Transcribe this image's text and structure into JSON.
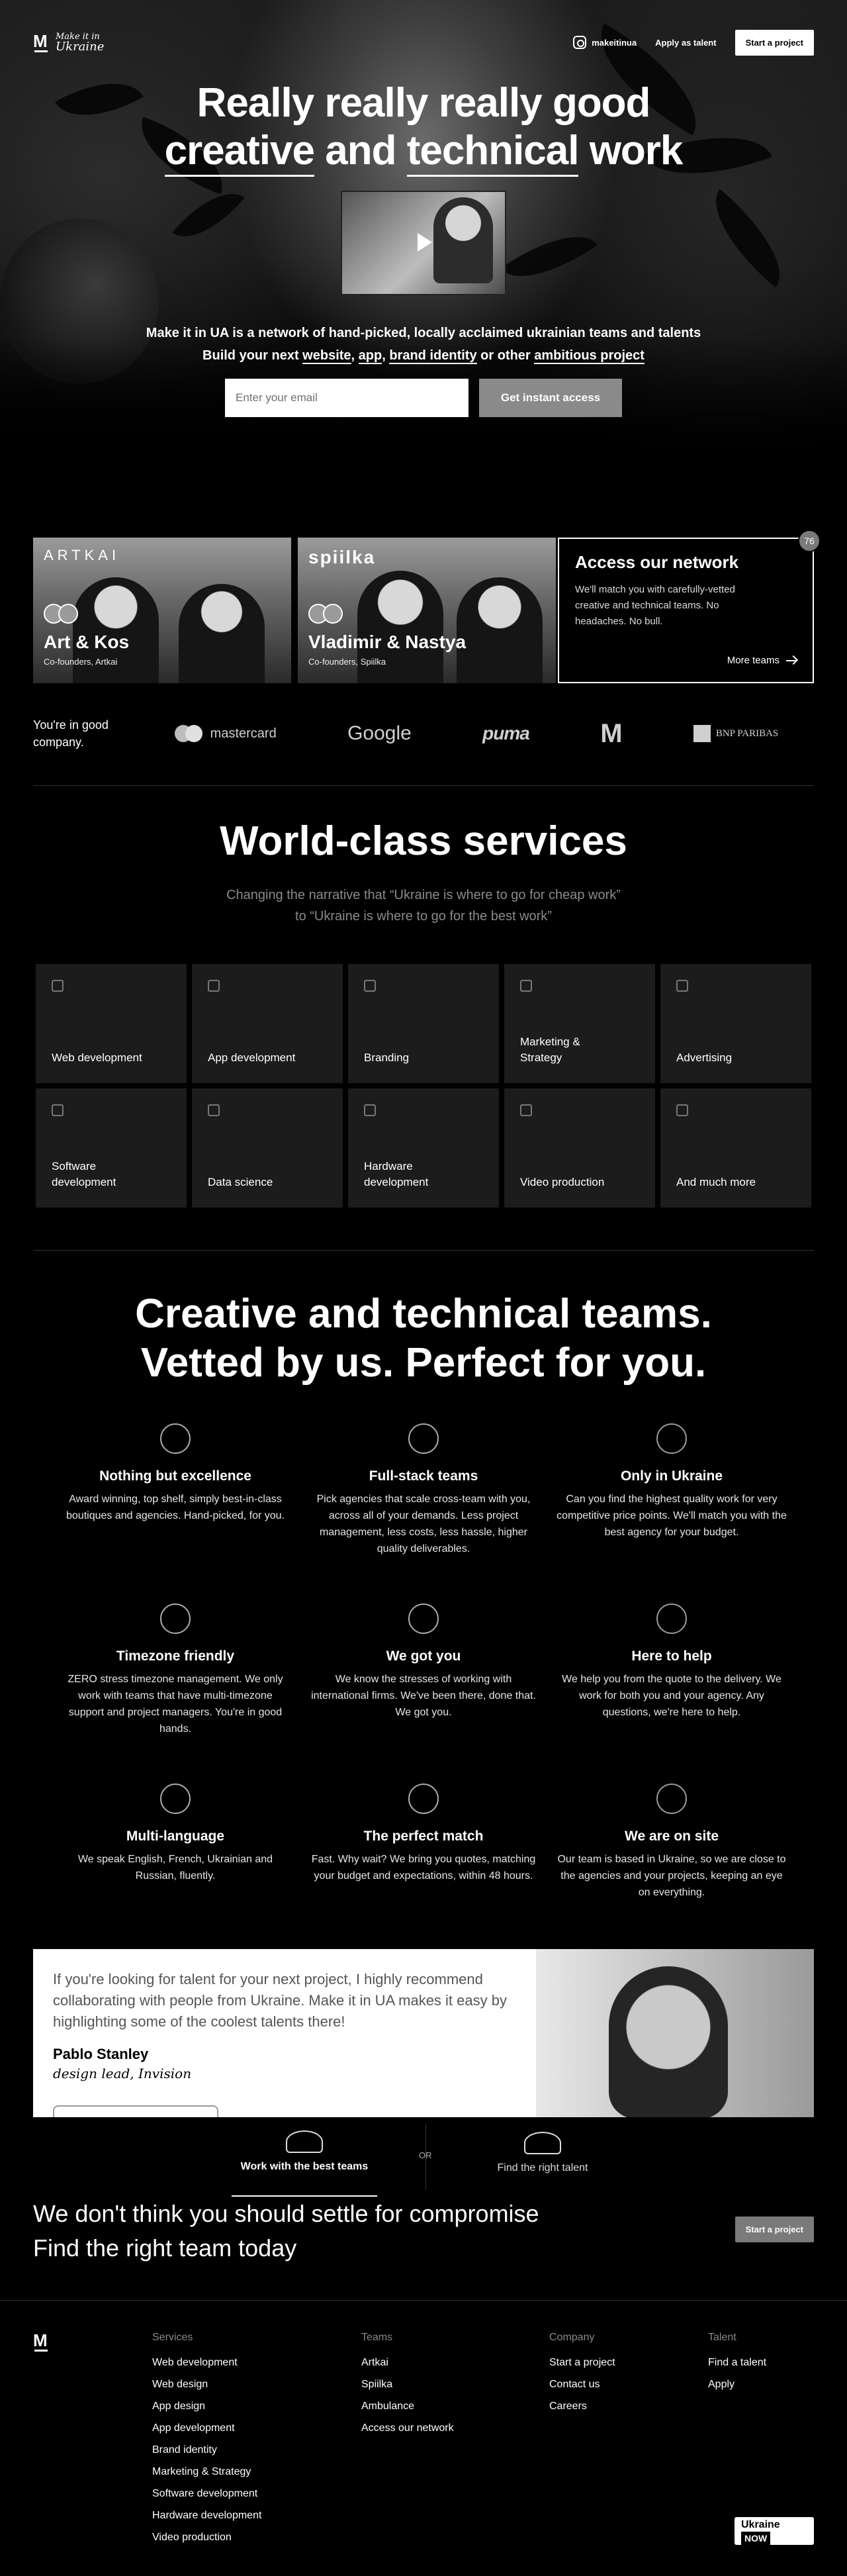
{
  "nav": {
    "logo_line1": "Make it in",
    "logo_line2": "Ukraine",
    "instagram_label": "makeitinua",
    "apply_label": "Apply as talent",
    "start_project_label": "Start a project"
  },
  "hero": {
    "title_line1": "Really really really good",
    "title_line2_a": "creative",
    "title_line2_b": "and",
    "title_line2_c": "technical",
    "title_line2_d": "work",
    "subtitle": "Make it in UA is a network of hand-picked, locally acclaimed ukrainian teams and talents",
    "sub2": {
      "prefix": "Build your next",
      "website": "website",
      "app": "app",
      "brand": "brand identity",
      "or_other": "or other",
      "ambitious": "ambitious project"
    },
    "email_placeholder": "Enter your email",
    "cta_label": "Get instant access"
  },
  "teams": [
    {
      "brand": "ARTKAI",
      "name": "Art & Kos",
      "role": "Co-founders, Artkai"
    },
    {
      "brand": "spiilka",
      "name": "Vladimir & Nastya",
      "role": "Co-founders, Spiilka"
    }
  ],
  "access_card": {
    "title": "Access our network",
    "text": "We'll match you with carefully-vetted creative and technical teams. No headaches. No bull.",
    "link": "More teams",
    "badge": "76"
  },
  "clients": {
    "label": "You're in good company.",
    "mastercard": "mastercard",
    "google": "Google",
    "puma": "puma",
    "mcdonalds": "M",
    "bnp": "BNP PARIBAS"
  },
  "services": {
    "title": "World-class services",
    "subtitle_1": "Changing the narrative that “Ukraine is where to go for cheap work”",
    "subtitle_2": "to “Ukraine is where to go for the best work”",
    "items": [
      {
        "label": "Web development",
        "icon": "layout-icon"
      },
      {
        "label": "App development",
        "icon": "phone-icon"
      },
      {
        "label": "Branding",
        "icon": "pen-tool-icon"
      },
      {
        "label": "Marketing & Strategy",
        "icon": "trending-up-icon"
      },
      {
        "label": "Advertising",
        "icon": "book-open-icon"
      },
      {
        "label": "Software development",
        "icon": "database-icon"
      },
      {
        "label": "Data science",
        "icon": "pie-chart-icon"
      },
      {
        "label": "Hardware development",
        "icon": "hard-drive-icon"
      },
      {
        "label": "Video production",
        "icon": "video-icon"
      },
      {
        "label": "And much more",
        "icon": "more-horizontal-icon"
      }
    ]
  },
  "features": {
    "title_1": "Creative and technical teams.",
    "title_2": "Vetted by us. Perfect for you.",
    "items": [
      {
        "title": "Nothing but excellence",
        "text": "Award winning, top shelf, simply best-in-class boutiques and agencies. Hand-picked, for you.",
        "icon": "award-icon"
      },
      {
        "title": "Full-stack teams",
        "text": "Pick agencies that scale cross-team with you, across all of your demands. Less project management, less costs, less hassle, higher quality deliverables.",
        "icon": "users-icon"
      },
      {
        "title": "Only in Ukraine",
        "text": "Can you find the highest quality work for very competitive price points. We'll match you with the best agency for your budget.",
        "icon": "dollar-icon"
      },
      {
        "title": "Timezone friendly",
        "text": "ZERO stress timezone management. We only work with teams that have multi-timezone support and project managers. You're in good hands.",
        "icon": "clock-icon"
      },
      {
        "title": "We got you",
        "text": "We know the stresses of working with international firms. We've been there, done that. We got you.",
        "icon": "smile-icon"
      },
      {
        "title": "Here to help",
        "text": "We help you from the quote to the delivery. We work for both you and your agency. Any questions, we're here to help.",
        "icon": "user-check-icon"
      },
      {
        "title": "Multi-language",
        "text": "We speak English, French, Ukrainian and Russian, fluently.",
        "icon": "globe-icon"
      },
      {
        "title": "The perfect match",
        "text": "Fast. Why wait? We bring you quotes, matching your budget and expectations, within 48 hours.",
        "icon": "zap-icon"
      },
      {
        "title": "We are on site",
        "text": "Our team is based in Ukraine, so we are close to the agencies and your projects, keeping an eye on everything.",
        "icon": "map-pin-icon"
      }
    ]
  },
  "testimonial": {
    "quote": "If you're looking for talent for your next project, I highly recommend collaborating with people from Ukraine. Make it in UA makes it easy by highlighting some of the coolest talents there!",
    "name": "Pablo Stanley",
    "role": "design lead, Invision"
  },
  "tabs": {
    "active": "Work with the best teams",
    "or": "OR",
    "inactive": "Find the right talent"
  },
  "cta": {
    "line1": "We don't think you should settle for compromise",
    "line2": "Find the right team today",
    "button": "Start a project"
  },
  "footer": {
    "columns": [
      {
        "head": "Services",
        "links": [
          "Web development",
          "Web design",
          "App design",
          "App development",
          "Brand identity",
          "Marketing & Strategy",
          "Software development",
          "Hardware development",
          "Video production"
        ]
      },
      {
        "head": "Teams",
        "links": [
          "Artkai",
          "Spiilka",
          "Ambulance",
          "Access our network"
        ]
      },
      {
        "head": "Company",
        "links": [
          "Start a project",
          "Contact us",
          "Careers"
        ]
      },
      {
        "head": "Talent",
        "links": [
          "Find a talent",
          "Apply"
        ]
      }
    ],
    "badge_top": "Ukraine",
    "badge_bottom": "NOW"
  }
}
